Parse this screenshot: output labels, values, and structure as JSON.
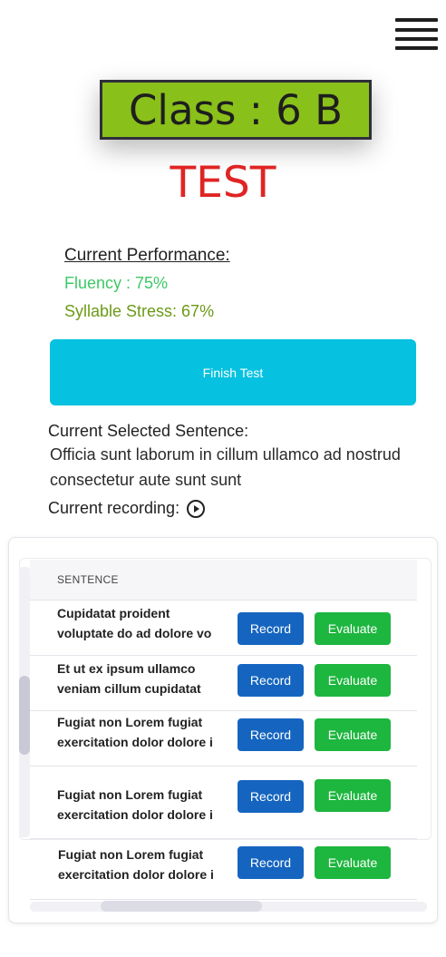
{
  "header": {
    "class_label": "Class : 6 B",
    "class_bg": "#8ac01a"
  },
  "test": {
    "title": "TEST",
    "title_color": "#e02424"
  },
  "performance": {
    "heading": "Current Performance:",
    "fluency": "Fluency : 75%",
    "fluency_color": "#3ec866",
    "syllable": "Syllable Stress: 67%",
    "syllable_color": "#6b9a16"
  },
  "finish_button": {
    "label": "Finish Test",
    "color": "#06c1e0"
  },
  "selected": {
    "label": "Current Selected Sentence:",
    "text": "Officia sunt laborum in cillum ullamco ad nostrud consectetur aute sunt sunt"
  },
  "recording": {
    "label": "Current recording:",
    "icon": "play-circle-icon"
  },
  "table": {
    "header": "SENTENCE",
    "record_label": "Record",
    "evaluate_label": "Evaluate",
    "record_color": "#1565c0",
    "evaluate_color": "#1db63e",
    "rows": [
      {
        "line1": "Cupidatat proident",
        "line2": "voluptate do ad dolore vo"
      },
      {
        "line1": "Et ut ex ipsum ullamco",
        "line2": "veniam cillum cupidatat"
      },
      {
        "line1": "Fugiat non Lorem fugiat",
        "line2": "exercitation dolor dolore i"
      },
      {
        "line1": "Fugiat non Lorem fugiat",
        "line2": "exercitation dolor dolore i"
      },
      {
        "line1": "Fugiat non Lorem fugiat",
        "line2": "exercitation dolor dolore i"
      }
    ]
  }
}
